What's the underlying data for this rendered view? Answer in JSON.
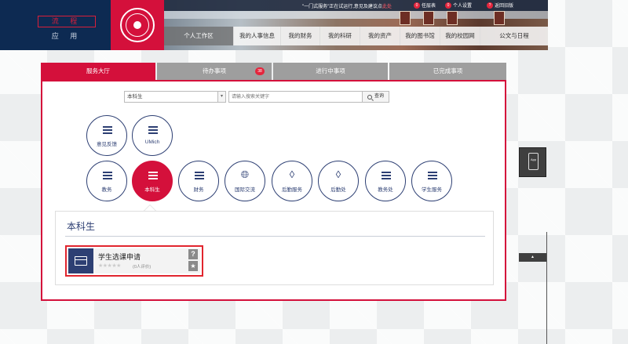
{
  "header": {
    "app_top": "流 程",
    "app_bottom": "应 用",
    "notice": {
      "text": "\"一门式服务\"正在试运行,意见及建议点",
      "link": "此处"
    },
    "quick_links": [
      {
        "num": "0",
        "label": "任层表"
      },
      {
        "num": "0",
        "label": "个人设置"
      },
      {
        "num": "?",
        "label": "返回旧版"
      }
    ],
    "nav": [
      {
        "label": "个人工作区"
      },
      {
        "label": "我的人事信息"
      },
      {
        "label": "我的财务"
      },
      {
        "label": "我的科研"
      },
      {
        "label": "我的资产"
      },
      {
        "label": "我的图书馆"
      },
      {
        "label": "我的校园网"
      },
      {
        "label": "公文与日程"
      }
    ]
  },
  "tabs": [
    {
      "label": "服务大厅"
    },
    {
      "label": "待办事项",
      "badge": "38"
    },
    {
      "label": "进行中事项"
    },
    {
      "label": "已完成事项"
    }
  ],
  "search": {
    "category_value": "本科生",
    "placeholder": "请输入搜索关键字",
    "button_label": "查询"
  },
  "categories_row1": [
    {
      "label": "意见反馈",
      "icon": "list-icon"
    },
    {
      "label": "UMich",
      "icon": "list-icon"
    }
  ],
  "categories_row2": [
    {
      "label": "教务",
      "icon": "list-icon"
    },
    {
      "label": "本科生",
      "icon": "list-icon"
    },
    {
      "label": "财务",
      "icon": "list-icon"
    },
    {
      "label": "国际交流",
      "icon": "globe-icon"
    },
    {
      "label": "后勤服务",
      "icon": "layers-icon"
    },
    {
      "label": "后勤处",
      "icon": "layers-icon"
    },
    {
      "label": "教务处",
      "icon": "list-icon"
    },
    {
      "label": "学生服务",
      "icon": "list-icon"
    }
  ],
  "section": {
    "title": "本科生",
    "service": {
      "name": "学生选课申请",
      "rating": "★★★★★",
      "count": "(0人评价)"
    }
  },
  "side": {
    "app_label": "App",
    "top_label": "▲"
  },
  "colors": {
    "brand_red": "#d4103b",
    "navy": "#2d3f73",
    "header_bg": "#0d2a52"
  }
}
